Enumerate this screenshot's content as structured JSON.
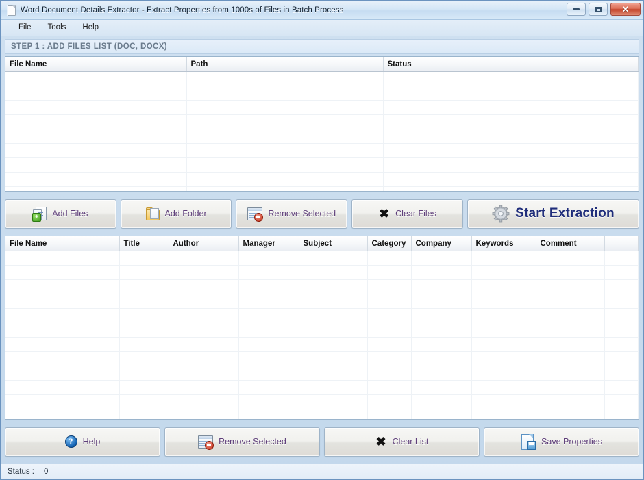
{
  "window": {
    "title": "Word Document Details Extractor - Extract Properties from 1000s of Files in Batch Process",
    "icon": "document-icon",
    "controls": {
      "minimize": "–",
      "maximize": "□",
      "close": "✕"
    }
  },
  "menubar": {
    "items": [
      {
        "label": "File"
      },
      {
        "label": "Tools"
      },
      {
        "label": "Help"
      }
    ]
  },
  "step": {
    "heading": "STEP 1 : ADD FILES LIST (DOC, DOCX)"
  },
  "files_grid": {
    "columns": [
      "File Name",
      "Path",
      "Status",
      ""
    ],
    "rows": []
  },
  "files_toolbar": {
    "buttons": [
      {
        "label": "Add Files",
        "icon": "add-files-icon"
      },
      {
        "label": "Add Folder",
        "icon": "add-folder-icon"
      },
      {
        "label": "Remove Selected",
        "icon": "remove-selected-icon"
      },
      {
        "label": "Clear Files",
        "icon": "clear-icon"
      },
      {
        "label": "Start Extraction",
        "icon": "gear-icon"
      }
    ]
  },
  "properties_grid": {
    "columns": [
      "File Name",
      "Title",
      "Author",
      "Manager",
      "Subject",
      "Category",
      "Company",
      "Keywords",
      "Comment",
      ""
    ],
    "rows": []
  },
  "results_toolbar": {
    "buttons": [
      {
        "label": "Help",
        "icon": "help-icon"
      },
      {
        "label": "Remove Selected",
        "icon": "remove-selected-icon"
      },
      {
        "label": "Clear List",
        "icon": "clear-icon"
      },
      {
        "label": "Save Properties",
        "icon": "save-properties-icon"
      }
    ]
  },
  "statusbar": {
    "label": "Status :",
    "value": "0"
  },
  "colors": {
    "accent_blue": "#1f2d7a",
    "button_text": "#5f3f7a",
    "step_text": "#6a7b8c",
    "close_red": "#c4452c",
    "frame_blue": "#c3d8ec"
  }
}
